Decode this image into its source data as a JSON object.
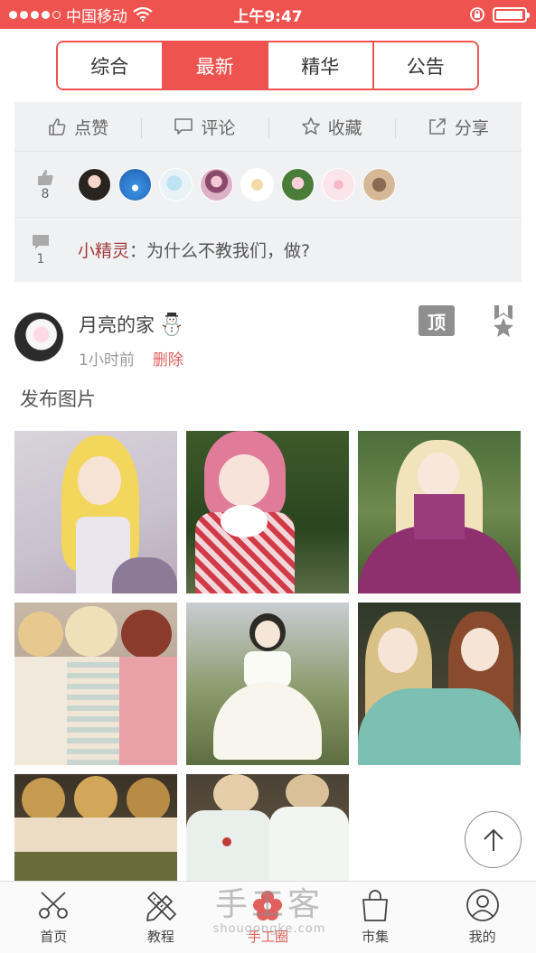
{
  "status_bar": {
    "carrier": "中国移动",
    "time": "上午9:47",
    "battery_level": 0.95
  },
  "segments": [
    {
      "label": "综合",
      "active": false
    },
    {
      "label": "最新",
      "active": true
    },
    {
      "label": "精华",
      "active": false
    },
    {
      "label": "公告",
      "active": false
    }
  ],
  "previous_post": {
    "actions": [
      {
        "icon": "thumbs-up-icon",
        "label": "点赞"
      },
      {
        "icon": "comment-icon",
        "label": "评论"
      },
      {
        "icon": "star-icon",
        "label": "收藏"
      },
      {
        "icon": "share-icon",
        "label": "分享"
      }
    ],
    "like_count": "8",
    "comment_count": "1",
    "comment": {
      "author": "小精灵",
      "separator": "：",
      "text": "为什么不教我们，做?"
    }
  },
  "post": {
    "author": "月亮的家",
    "time": "1小时前",
    "delete_label": "删除",
    "top_badge": "顶",
    "caption": "发布图片",
    "image_count": 8
  },
  "tabs": [
    {
      "label": "首页",
      "icon": "scissors-icon"
    },
    {
      "label": "教程",
      "icon": "pencil-ruler-icon"
    },
    {
      "label": "手工圈",
      "icon": "flower-icon",
      "active": true
    },
    {
      "label": "市集",
      "icon": "shopping-bag-icon"
    },
    {
      "label": "我的",
      "icon": "profile-icon"
    }
  ],
  "watermark": {
    "big": "手工客",
    "small": "shougongke.com"
  },
  "colors": {
    "accent": "#ef5350",
    "author_link": "#a33c3c",
    "delete": "#e0605d"
  }
}
